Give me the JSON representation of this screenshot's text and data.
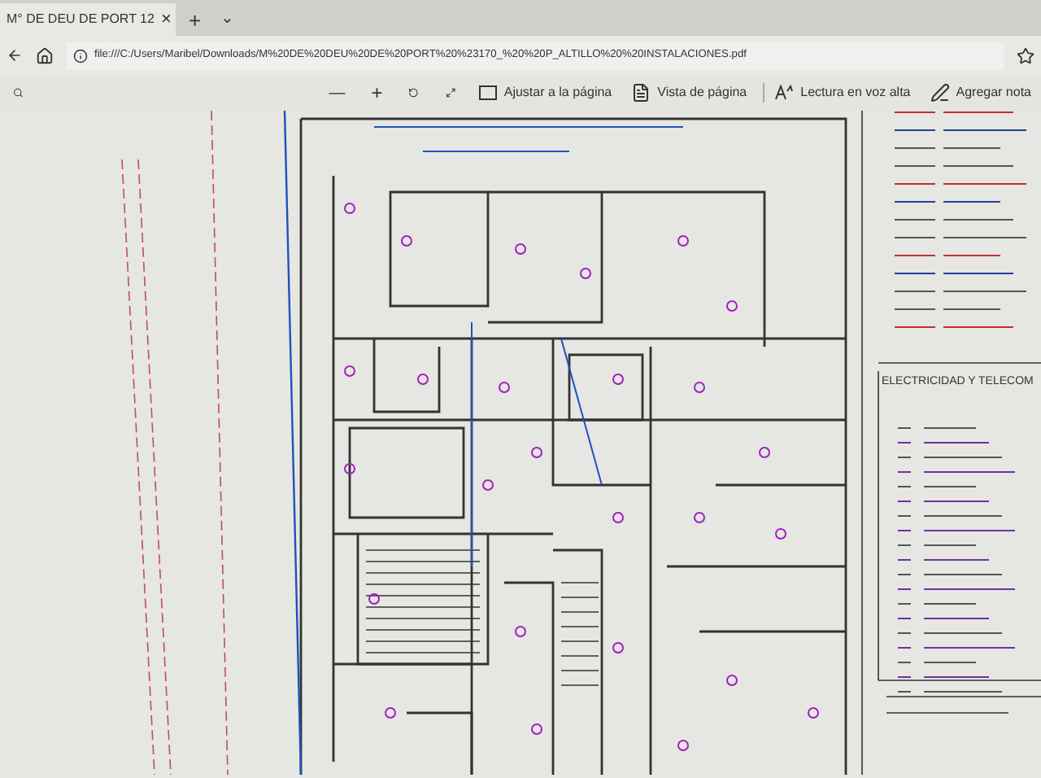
{
  "tab": {
    "title": "M° DE DEU DE PORT 12",
    "close": "×",
    "new_tab": "+",
    "menu": "⌄"
  },
  "address_bar": {
    "url": "file:///C:/Users/Maribel/Downloads/M%20DE%20DEU%20DE%20PORT%20%23170_%20%20P_ALTILLO%20%20INSTALACIONES.pdf"
  },
  "toolbar": {
    "zoom_out": "—",
    "zoom_in": "+",
    "items": [
      {
        "kind": "fit",
        "label": "Ajustar a la página"
      },
      {
        "kind": "view",
        "label": "Vista de página"
      },
      {
        "kind": "read",
        "label": "Lectura en voz alta"
      },
      {
        "kind": "note",
        "label": "Agregar nota"
      }
    ]
  },
  "legend": {
    "heading": "ELECTRICIDAD Y TELECOM"
  }
}
